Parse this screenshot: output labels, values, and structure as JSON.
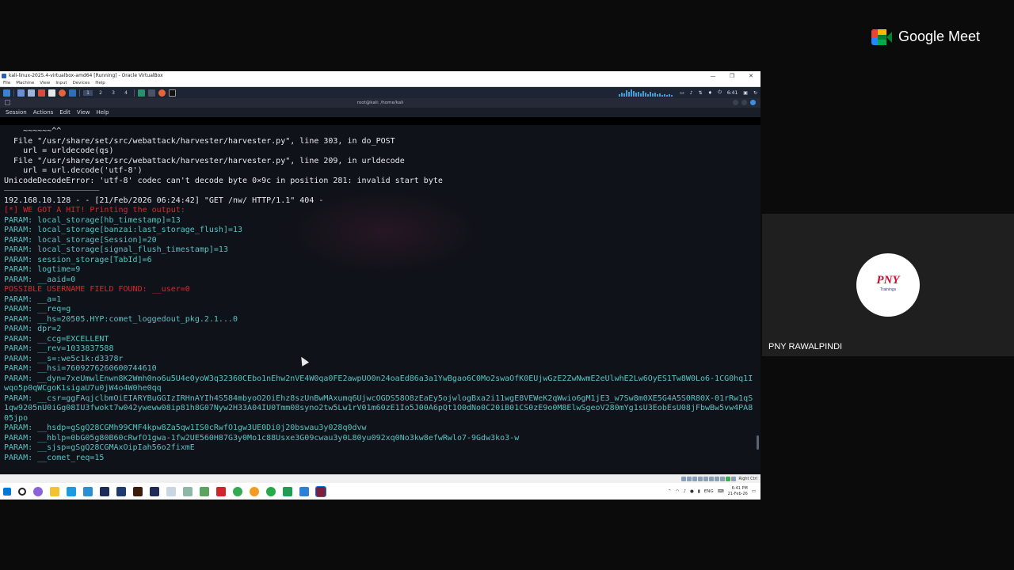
{
  "virtualbox": {
    "title": "kali-linux-2025.4-virtualbox-amd64 [Running] - Oracle VirtualBox",
    "menu": [
      "File",
      "Machine",
      "View",
      "Input",
      "Devices",
      "Help"
    ],
    "win_controls": [
      "—",
      "❐",
      "✕"
    ]
  },
  "kali_panel": {
    "workspaces": [
      "1",
      "2",
      "3",
      "4"
    ],
    "clock": "6:41"
  },
  "terminal": {
    "title": "root@kali: /home/kali",
    "menu": [
      "Session",
      "Actions",
      "Edit",
      "View",
      "Help"
    ],
    "lines": [
      {
        "kind": "white",
        "text": "    ~~~~~~^^"
      },
      {
        "kind": "white",
        "text": "  File \"/usr/share/set/src/webattack/harvester/harvester.py\", line 303, in do_POST"
      },
      {
        "kind": "white",
        "text": "    url = urldecode(qs)"
      },
      {
        "kind": "white",
        "text": "  File \"/usr/share/set/src/webattack/harvester/harvester.py\", line 209, in urldecode"
      },
      {
        "kind": "white",
        "text": "    url = url.decode('utf-8')"
      },
      {
        "kind": "white",
        "text": "UnicodeDecodeError: 'utf-8' codec can't decode byte 0×9c in position 281: invalid start byte"
      },
      {
        "kind": "rule",
        "text": "————————————————————————————————————————"
      },
      {
        "kind": "white",
        "text": "192.168.10.128 - - [21/Feb/2026 06:24:42] \"GET /nw/ HTTP/1.1\" 404 -"
      },
      {
        "kind": "red",
        "text": "[*] WE GOT A HIT! Printing the output:"
      },
      {
        "kind": "param",
        "text": "PARAM: local_storage[hb_timestamp]=13"
      },
      {
        "kind": "param",
        "text": "PARAM: local_storage[banzai:last_storage_flush]=13"
      },
      {
        "kind": "param",
        "text": "PARAM: local_storage[Session]=20"
      },
      {
        "kind": "param",
        "text": "PARAM: local_storage[signal_flush_timestamp]=13"
      },
      {
        "kind": "param",
        "text": "PARAM: session_storage[TabId]=6"
      },
      {
        "kind": "param",
        "text": "PARAM: logtime=9"
      },
      {
        "kind": "param",
        "text": "PARAM: __aaid=0"
      },
      {
        "kind": "red",
        "text": "POSSIBLE USERNAME FIELD FOUND: __user=0"
      },
      {
        "kind": "param",
        "text": "PARAM: __a=1"
      },
      {
        "kind": "param",
        "text": "PARAM: __req=g"
      },
      {
        "kind": "param",
        "text": "PARAM: __hs=20505.HYP:comet_loggedout_pkg.2.1...0"
      },
      {
        "kind": "param",
        "text": "PARAM: dpr=2"
      },
      {
        "kind": "param",
        "text": "PARAM: __ccg=EXCELLENT"
      },
      {
        "kind": "param",
        "text": "PARAM: __rev=1033837588"
      },
      {
        "kind": "param",
        "text": "PARAM: __s=:we5c1k:d3378r"
      },
      {
        "kind": "param",
        "text": "PARAM: __hsi=7609276260600744610"
      },
      {
        "kind": "param-wrap",
        "text": "PARAM: __dyn=7xeUmwlEnwn8K2Wmh0no6u5U4e0yoW3q32360CEbo1nEhw2nVE4W0qa0FE2awpUO0n24oaEd86a3a1YwBgao6C0Mo2swaOfK0EUjwGzE2ZwNwmE2eUlwhE2Lw6OyES1Tw8W0Lo6-1CG0hq1Iwqo5p0qWCgoK1sigaU7u0jW4o4W0he0qq"
      },
      {
        "kind": "param-wrap",
        "text": "PARAM: __csr=ggFAqjclbmOiEIARYBuGGIzIRHnAYIh4S584mbyoO2OiEhz8szUnBwMAxumq6UjwcOGDS58O8zEaEy5ojwlogBxa2i11wgE8VEWeK2qWwio6gM1jE3_w7Sw8m0XE5G4A5S0R80X-01rRw1qS1qw9205nU0iGg08IU3fwokt7w042yweww08ip81h8G07Nyw2H33A04IU0Tmm08syno2tw5Lw1rV01m60zE1Io5J00A6pQt1O0dNo0C20iB01CS0zE9o0M8ElwSgeoV280mYg1sU3EobEsU08jFbwBw5vw4PA805jpo"
      },
      {
        "kind": "param",
        "text": "PARAM: __hsdp=gSgQ28CGMh99CMF4kpw8Za5qw1IS0cRwfO1gw3UE0Di0j20bswau3y028q0dvw"
      },
      {
        "kind": "param",
        "text": "PARAM: __hblp=0bG05g80B60cRwfO1gwa-1fw2UE560H87G3y0Mo1c88Usxe3G09cwau3y0L80yu092xq0No3kw8efwRwlo7-9Gdw3ko3-w"
      },
      {
        "kind": "param",
        "text": "PARAM: __sjsp=gSgQ28CGMAxOipIah56o2fixmE"
      },
      {
        "kind": "param",
        "text": "PARAM: __comet_req=15"
      }
    ]
  },
  "windows_taskbar": {
    "tray_lang": "ENG",
    "time": "6:41 PM",
    "date": "21-Feb-26",
    "status_text": "Right Ctrl"
  },
  "meet": {
    "logo_text": "Google Meet",
    "participant_name": "PNY RAWALPINDI",
    "avatar_logo": "PNY",
    "avatar_sub": "Trainings"
  },
  "colors": {
    "terminal_bg": "#0f1218",
    "param_text": "#58c3c3",
    "alert_text": "#e0262b"
  }
}
